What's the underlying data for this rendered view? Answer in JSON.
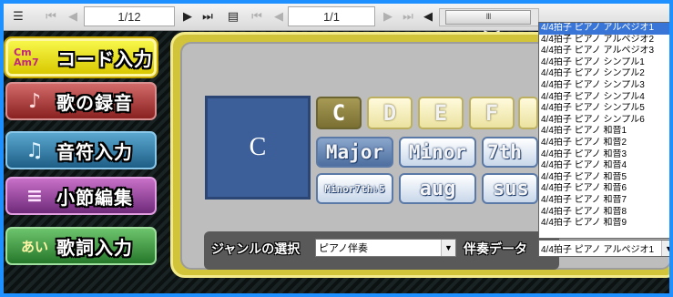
{
  "toolbar": {
    "page_counter_1": "1/12",
    "page_counter_2": "1/1",
    "scroll_grip": "III"
  },
  "menu": [
    {
      "label": "コード入力",
      "icon_text": "Cm Am7"
    },
    {
      "label": "歌の録音",
      "icon_text": "♪"
    },
    {
      "label": "音符入力",
      "icon_text": "♫"
    },
    {
      "label": "小節編集",
      "icon_text": "≡"
    },
    {
      "label": "歌詞入力",
      "icon_text": "あい"
    }
  ],
  "chord": {
    "current": "C",
    "roots": [
      "C",
      "D",
      "E",
      "F"
    ],
    "qualities_row1": [
      "Major",
      "Minor",
      "7th"
    ],
    "qualities_row2": [
      "Minor7th♭5",
      "aug",
      "sus"
    ]
  },
  "genre": {
    "label": "ジャンルの選択",
    "selected": "ピアノ伴奏",
    "data_label": "伴奏データ"
  },
  "accompaniment_dropdown": {
    "selected": "4/4拍子 ピアノ アルペジオ1",
    "options": [
      "4/4拍子 ピアノ アルペジオ1",
      "4/4拍子 ピアノ アルペジオ2",
      "4/4拍子 ピアノ アルペジオ3",
      "4/4拍子 ピアノ シンプル1",
      "4/4拍子 ピアノ シンプル2",
      "4/4拍子 ピアノ シンプル3",
      "4/4拍子 ピアノ シンプル4",
      "4/4拍子 ピアノ シンプル5",
      "4/4拍子 ピアノ シンプル6",
      "4/4拍子 ピアノ 和音1",
      "4/4拍子 ピアノ 和音2",
      "4/4拍子 ピアノ 和音3",
      "4/4拍子 ピアノ 和音4",
      "4/4拍子 ピアノ 和音5",
      "4/4拍子 ピアノ 和音6",
      "4/4拍子 ピアノ 和音7",
      "4/4拍子 ピアノ 和音8",
      "4/4拍子 ピアノ 和音9"
    ]
  },
  "colors": {
    "frame": "#1e90ff",
    "chord_box": "#3c5f9a",
    "highlight": "#3875d7"
  }
}
